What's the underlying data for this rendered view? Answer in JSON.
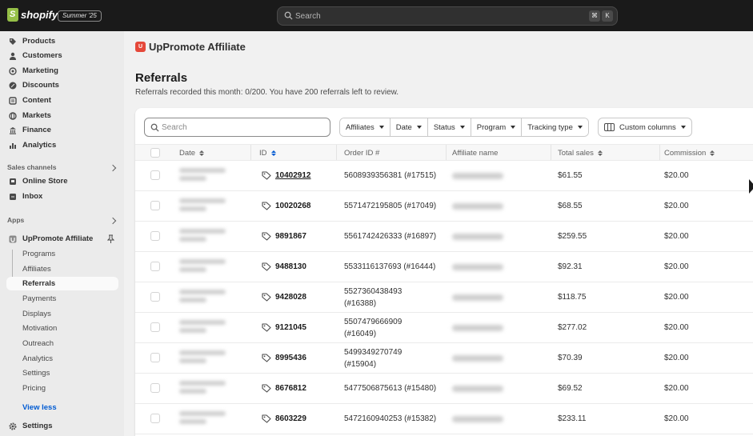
{
  "topbar": {
    "logo_text": "shopify",
    "edition": "Summer '25",
    "search_placeholder": "Search",
    "shortcut_keys": [
      "⌘",
      "K"
    ]
  },
  "sidebar": {
    "items": [
      {
        "label": "Products",
        "icon": "tag-icon"
      },
      {
        "label": "Customers",
        "icon": "person-icon"
      },
      {
        "label": "Marketing",
        "icon": "target-icon"
      },
      {
        "label": "Discounts",
        "icon": "discount-icon"
      },
      {
        "label": "Content",
        "icon": "content-icon"
      },
      {
        "label": "Markets",
        "icon": "globe-icon"
      },
      {
        "label": "Finance",
        "icon": "bank-icon"
      },
      {
        "label": "Analytics",
        "icon": "chart-icon"
      }
    ],
    "sales_channels_title": "Sales channels",
    "sales_channels": [
      {
        "label": "Online Store",
        "icon": "store-icon"
      },
      {
        "label": "Inbox",
        "icon": "inbox-icon"
      }
    ],
    "apps_title": "Apps",
    "app": {
      "label": "UpPromote Affiliate",
      "icon": "app-icon"
    },
    "app_subitems": [
      "Programs",
      "Affiliates",
      "Referrals",
      "Payments",
      "Displays",
      "Motivation",
      "Outreach",
      "Analytics",
      "Settings",
      "Pricing"
    ],
    "active_subitem": "Referrals",
    "view_less": "View less",
    "settings": "Settings"
  },
  "main": {
    "app_name": "UpPromote Affiliate",
    "app_logo_letter": "U",
    "page_title": "Referrals",
    "page_subtitle": "Referrals recorded this month: 0/200. You have 200 referrals left to review.",
    "search_placeholder": "Search",
    "filters": [
      "Affiliates",
      "Date",
      "Status",
      "Program",
      "Tracking type"
    ],
    "custom_columns": "Custom columns",
    "columns": {
      "date": "Date",
      "id": "ID",
      "order_id": "Order ID #",
      "affiliate_name": "Affiliate name",
      "total_sales": "Total sales",
      "commission": "Commission"
    },
    "rows": [
      {
        "id": "10402912",
        "order": "5608939356381 (#17515)",
        "sales": "$61.55",
        "commission": "$20.00"
      },
      {
        "id": "10020268",
        "order": "5571472195805 (#17049)",
        "sales": "$68.55",
        "commission": "$20.00"
      },
      {
        "id": "9891867",
        "order": "5561742426333 (#16897)",
        "sales": "$259.55",
        "commission": "$20.00"
      },
      {
        "id": "9488130",
        "order": "5533116137693 (#16444)",
        "sales": "$92.31",
        "commission": "$20.00"
      },
      {
        "id": "9428028",
        "order": "5527360438493 (#16388)",
        "sales": "$118.75",
        "commission": "$20.00"
      },
      {
        "id": "9121045",
        "order": "5507479666909 (#16049)",
        "sales": "$277.02",
        "commission": "$20.00"
      },
      {
        "id": "8995436",
        "order": "5499349270749 (#15904)",
        "sales": "$70.39",
        "commission": "$20.00"
      },
      {
        "id": "8676812",
        "order": "5477506875613 (#15480)",
        "sales": "$69.52",
        "commission": "$20.00"
      },
      {
        "id": "8603229",
        "order": "5472160940253 (#15382)",
        "sales": "$233.11",
        "commission": "$20.00"
      }
    ]
  }
}
